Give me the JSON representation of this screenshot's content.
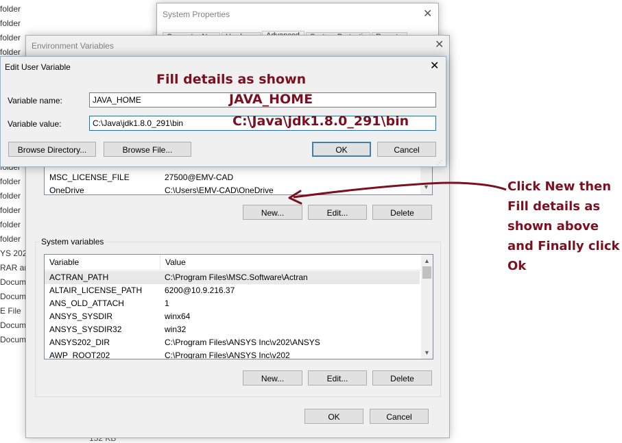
{
  "background_list": [
    "folder",
    "folder",
    "folder",
    "folder",
    "folder",
    "folder",
    "folder",
    "folder",
    "folder",
    "folder",
    "folder",
    "folder",
    "folder",
    "folder",
    "folder",
    "folder",
    "folder",
    "YS 202",
    "RAR arc",
    "Docum",
    "Docum",
    "E File",
    "Docum",
    "Document"
  ],
  "background_size": "152 KB",
  "system_properties": {
    "title": "System Properties",
    "tabs": [
      "Computer Name",
      "Hardware",
      "Advanced",
      "System Protection",
      "Remote"
    ]
  },
  "env_vars": {
    "title": "Environment Variables",
    "user_rows": [
      {
        "name": "MSC_LICENSE_FILE",
        "value": "27500@EMV-CAD"
      },
      {
        "name": "OneDrive",
        "value": "C:\\Users\\EMV-CAD\\OneDrive"
      }
    ],
    "user_buttons": {
      "new": "New...",
      "edit": "Edit...",
      "delete": "Delete"
    },
    "system_group_label": "System variables",
    "columns": {
      "variable": "Variable",
      "value": "Value"
    },
    "system_rows": [
      {
        "name": "ACTRAN_PATH",
        "value": "C:\\Program Files\\MSC.Software\\Actran"
      },
      {
        "name": "ALTAIR_LICENSE_PATH",
        "value": "6200@10.9.216.37"
      },
      {
        "name": "ANS_OLD_ATTACH",
        "value": "1"
      },
      {
        "name": "ANSYS_SYSDIR",
        "value": "winx64"
      },
      {
        "name": "ANSYS_SYSDIR32",
        "value": "win32"
      },
      {
        "name": "ANSYS202_DIR",
        "value": "C:\\Program Files\\ANSYS Inc\\v202\\ANSYS"
      },
      {
        "name": "AWP_ROOT202",
        "value": "C:\\Program Files\\ANSYS Inc\\v202"
      }
    ],
    "system_buttons": {
      "new": "New...",
      "edit": "Edit...",
      "delete": "Delete"
    },
    "ok": "OK",
    "cancel": "Cancel"
  },
  "edit_dialog": {
    "title": "Edit User Variable",
    "name_label": "Variable name:",
    "name_value": "JAVA_HOME",
    "value_label": "Variable value:",
    "value_value": "C:\\Java\\jdk1.8.0_291\\bin",
    "browse_directory": "Browse Directory...",
    "browse_file": "Browse File...",
    "ok": "OK",
    "cancel": "Cancel"
  },
  "annotations": {
    "header": "Fill details as shown",
    "name_hint": "JAVA_HOME",
    "value_hint": "C:\\Java\\jdk1.8.0_291\\bin",
    "instruction": [
      "Click New then",
      "Fill details as",
      "shown above",
      "and Finally click",
      "Ok"
    ],
    "accent_color": "#7b1020"
  }
}
